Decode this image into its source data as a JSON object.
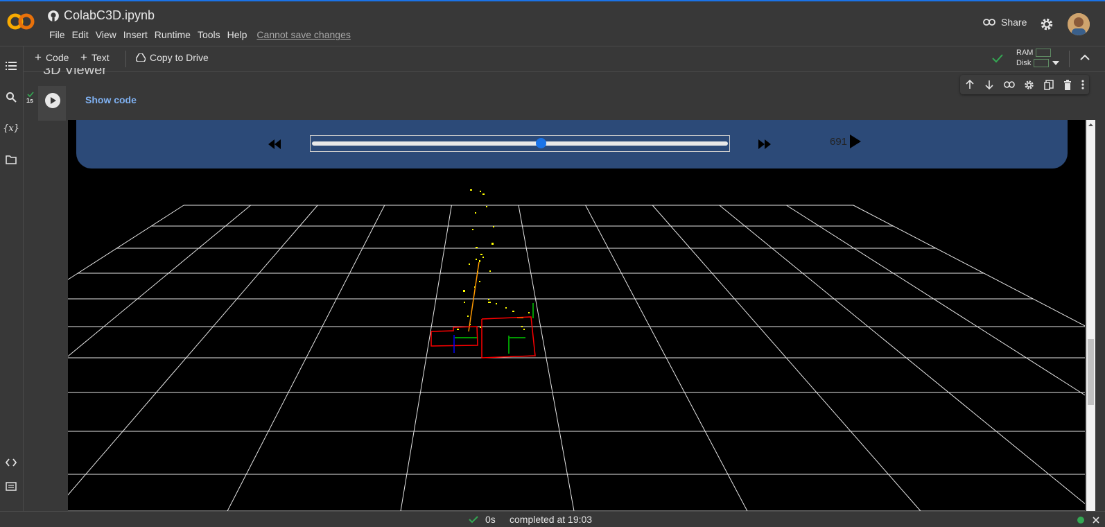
{
  "colors": {
    "accent_blue": "#1a73e8",
    "logo_orange": "#f9ab00",
    "check_green": "#34a853",
    "player_bg": "#2c4a78",
    "slider_thumb": "#1a73e8",
    "grid_line": "#ffffff",
    "points_yellow": "#ffff00",
    "box_red": "#ff0000"
  },
  "header": {
    "logo": "colab-co-logo",
    "github_icon": "github-icon",
    "title": "ColabC3D.ipynb",
    "menu": [
      "File",
      "Edit",
      "View",
      "Insert",
      "Runtime",
      "Tools",
      "Help"
    ],
    "save_notice": "Cannot save changes",
    "share_label": "Share"
  },
  "toolbar": {
    "code_label": "Code",
    "text_label": "Text",
    "copy_label": "Copy to Drive",
    "ram_label": "RAM",
    "disk_label": "Disk"
  },
  "cell": {
    "exec_time": "1s",
    "show_code": "Show code"
  },
  "viewer": {
    "frame_number": "691",
    "slider_fraction": 0.55
  },
  "statusbar": {
    "duration": "0s",
    "completed": "completed at 19:03"
  }
}
